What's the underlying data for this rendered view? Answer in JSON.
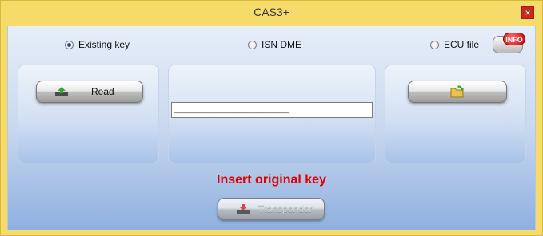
{
  "window": {
    "title": "CAS3+",
    "close_label": "×"
  },
  "options": [
    {
      "label": "Existing key",
      "selected": true
    },
    {
      "label": "ISN DME",
      "selected": false
    },
    {
      "label": "ECU file",
      "selected": false
    }
  ],
  "info": {
    "label": "INFO"
  },
  "read_button": {
    "label": "Read"
  },
  "key_field": {
    "value": "____________________"
  },
  "status": {
    "text": "Insert original key",
    "color": "#e00000"
  },
  "transponder_button": {
    "label": "Transponder",
    "enabled": false
  }
}
